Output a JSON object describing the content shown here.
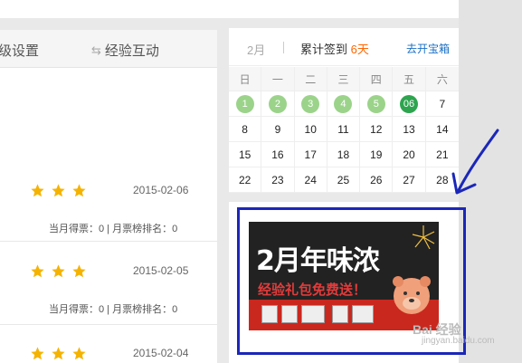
{
  "tabs": {
    "tab1_label": "级设置",
    "tab2_label": "经验互动"
  },
  "items": [
    {
      "date": "2015-02-06",
      "meta": "当月得票：0 | 月票榜排名：0"
    },
    {
      "date": "2015-02-05",
      "meta": "当月得票：0 | 月票榜排名：0"
    },
    {
      "date": "2015-02-04",
      "meta": ""
    }
  ],
  "calendar": {
    "month": "2月",
    "sign_prefix": "累计签到",
    "sign_days": "6天",
    "link": "去开宝箱",
    "weekdays": [
      "日",
      "一",
      "二",
      "三",
      "四",
      "五",
      "六"
    ],
    "weeks": [
      [
        "1",
        "2",
        "3",
        "4",
        "5",
        "06",
        "7"
      ],
      [
        "8",
        "9",
        "10",
        "11",
        "12",
        "13",
        "14"
      ],
      [
        "15",
        "16",
        "17",
        "18",
        "19",
        "20",
        "21"
      ],
      [
        "22",
        "23",
        "24",
        "25",
        "26",
        "27",
        "28"
      ]
    ]
  },
  "ad": {
    "title": "2月年味浓",
    "subtitle": "经验礼包免费送！"
  },
  "watermark": {
    "line1": "Bai 经验",
    "line2": "jingyan.baidu.com"
  },
  "colors": {
    "star": "#f5b301",
    "signed_dot": "#9bd38a",
    "today_dot": "#2ea44f",
    "annotation": "#1b27b8"
  }
}
